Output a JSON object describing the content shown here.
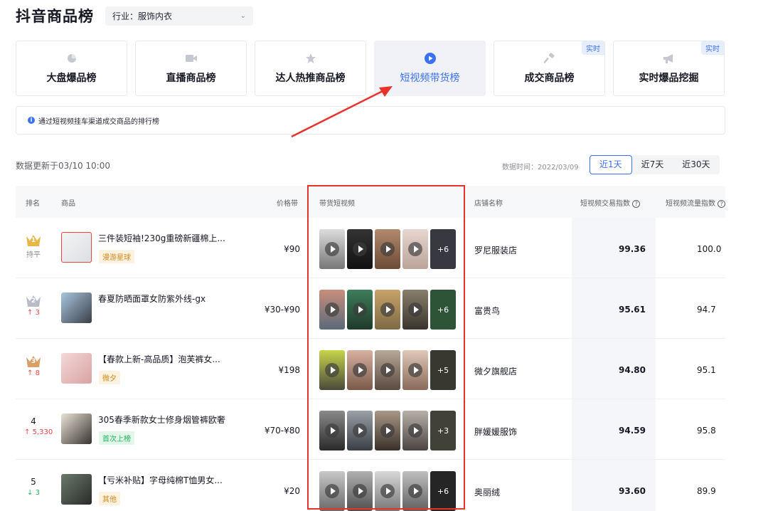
{
  "header": {
    "title": "抖音商品榜",
    "industry_select": "行业：服饰内衣"
  },
  "tabs": [
    {
      "label": "大盘爆品榜",
      "icon": "pie-chart-icon",
      "active": false,
      "badge": ""
    },
    {
      "label": "直播商品榜",
      "icon": "live-camera-icon",
      "active": false,
      "badge": ""
    },
    {
      "label": "达人热推商品榜",
      "icon": "star-icon",
      "active": false,
      "badge": ""
    },
    {
      "label": "短视频带货榜",
      "icon": "video-play-icon",
      "active": true,
      "badge": ""
    },
    {
      "label": "成交商品榜",
      "icon": "hammer-icon",
      "active": false,
      "badge": "实时"
    },
    {
      "label": "实时爆品挖掘",
      "icon": "megaphone-icon",
      "active": false,
      "badge": "实时"
    }
  ],
  "info": {
    "text": "通过短视频挂车渠道成交商品的排行榜"
  },
  "toolbar": {
    "updated": "数据更新于03/10 10:00",
    "data_time": "数据时间：2022/03/09",
    "ranges": [
      "近1天",
      "近7天",
      "近30天"
    ],
    "active_range": "近1天"
  },
  "table": {
    "headers": {
      "rank": "排名",
      "product": "商品",
      "price": "价格带",
      "videos": "带货短视频",
      "store": "店铺名称",
      "trade_index": "短视频交易指数",
      "flow_index": "短视频流量指数"
    },
    "rows": [
      {
        "rank": "1",
        "change": "持平",
        "change_dir": "flat",
        "name": "三件装短袖!230g重磅新疆棉上...",
        "tag": "漫游星球",
        "tag_color": "#f5a623",
        "price": "¥90",
        "more": "+6",
        "store": "罗尼服装店",
        "trade": "99.36",
        "flow": "100.0"
      },
      {
        "rank": "2",
        "change": "3",
        "change_dir": "up",
        "name": "春夏防晒面罩女防紫外线-gx",
        "tag": "",
        "tag_color": "",
        "price": "¥30-¥90",
        "more": "+6",
        "store": "富贵鸟",
        "trade": "95.61",
        "flow": "94.7"
      },
      {
        "rank": "3",
        "change": "8",
        "change_dir": "up",
        "name": "【春款上新-高品质】泡芙裤女...",
        "tag": "微夕",
        "tag_color": "#f5a623",
        "price": "¥198",
        "more": "+5",
        "store": "微夕旗舰店",
        "trade": "94.80",
        "flow": "95.1"
      },
      {
        "rank": "4",
        "change": "5,330",
        "change_dir": "up",
        "name": "305春季新款女士修身烟管裤欧奢",
        "tag": "首次上榜",
        "tag_color": "#1eb55c",
        "price": "¥70-¥80",
        "more": "+3",
        "store": "胖媛媛服饰",
        "trade": "94.59",
        "flow": "95.8"
      },
      {
        "rank": "5",
        "change": "3",
        "change_dir": "down",
        "name": "【亏米补贴】字母纯棉T恤男女...",
        "tag": "其他",
        "tag_color": "#f5a623",
        "price": "¥20",
        "more": "+6",
        "store": "奥丽绒",
        "trade": "93.60",
        "flow": "89.9"
      }
    ]
  },
  "colors": {
    "accent": "#3a6ff7",
    "annotation": "#e8332c",
    "up": "#f04142",
    "down": "#1eb55c",
    "gold": "#e9b64a",
    "silver": "#b8bcc6",
    "bronze": "#d9a066"
  }
}
